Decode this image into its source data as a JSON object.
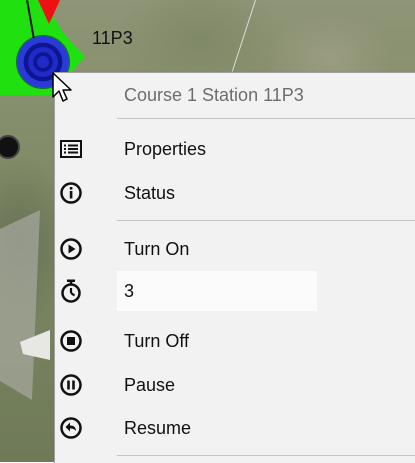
{
  "map": {
    "station_label": "11P3"
  },
  "context_menu": {
    "header": "Course 1 Station 11P3",
    "items": [
      {
        "label": "Properties",
        "icon": "list-icon"
      },
      {
        "label": "Status",
        "icon": "info-icon"
      },
      {
        "label": "Turn On",
        "icon": "play-icon"
      },
      {
        "label": "Turn Off",
        "icon": "stop-icon"
      },
      {
        "label": "Pause",
        "icon": "pause-icon"
      },
      {
        "label": "Resume",
        "icon": "resume-icon"
      }
    ],
    "duration_value": "3",
    "duration_icon": "stopwatch-icon"
  },
  "colors": {
    "menu_bg": "#f2f2f2",
    "header_text": "#6d6d6d",
    "station_blue": "#1f2ac8",
    "zone_green": "#20e010",
    "marker_red": "#ee1111"
  }
}
